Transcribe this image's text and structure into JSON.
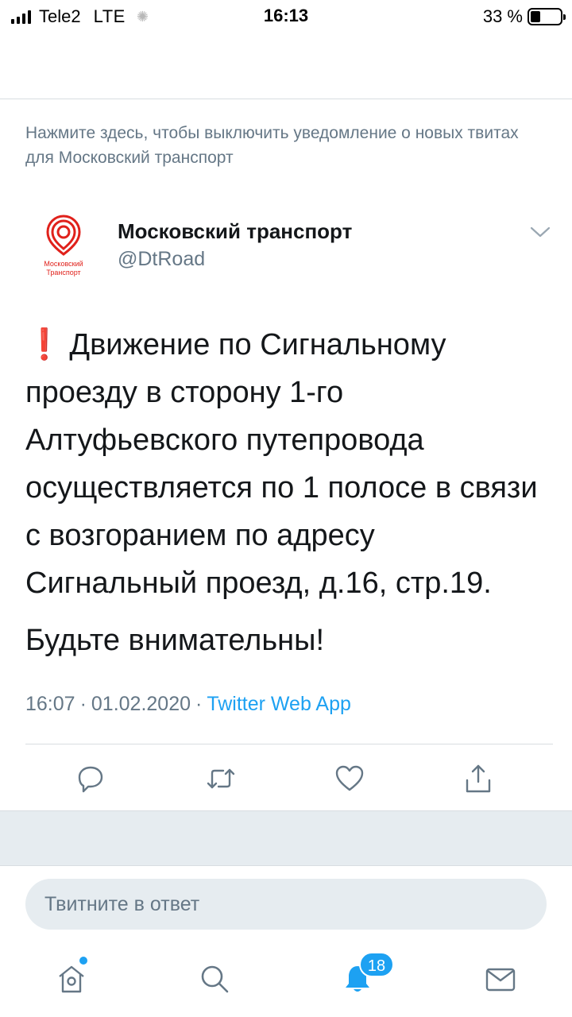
{
  "status_bar": {
    "carrier": "Tele2",
    "network": "LTE",
    "time": "16:13",
    "battery_label": "33 %",
    "battery_level": 0.33
  },
  "notification_notice": "Нажмите здесь, чтобы выключить уведомление о новых твитах для Московский транспорт",
  "tweet": {
    "author": {
      "name": "Московский транспорт",
      "handle": "@DtRoad",
      "avatar_line1": "Московский",
      "avatar_line2": "Транспорт"
    },
    "body_main": "Движение по Сигнальному проезду в сторону 1-го Алтуфьевского путепровода осуществляется по 1 полосе в связи с возгоранием по адресу Сигнальный проезд, д.16, стр.19.",
    "body_second": "Будьте внимательны!",
    "exclamation": "❗",
    "time": "16:07",
    "date": "01.02.2020",
    "source": "Twitter Web App",
    "separator": "·"
  },
  "actions": [
    "reply-icon",
    "retweet-icon",
    "like-icon",
    "share-icon"
  ],
  "reply_box": {
    "placeholder": "Твитните в ответ"
  },
  "tabbar": {
    "items": [
      "home-icon",
      "search-icon",
      "notifications-icon",
      "messages-icon"
    ],
    "notifications_badge": "18"
  },
  "colors": {
    "accent": "#1da1f2",
    "secondary_text": "#657786",
    "brand_red": "#e0211b"
  }
}
